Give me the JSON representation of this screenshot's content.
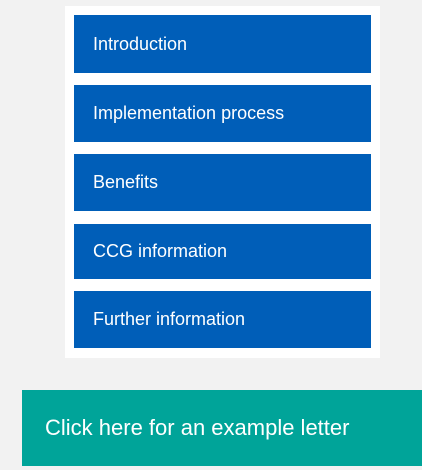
{
  "nav": {
    "items": [
      {
        "label": "Introduction"
      },
      {
        "label": "Implementation process"
      },
      {
        "label": "Benefits"
      },
      {
        "label": "CCG information"
      },
      {
        "label": "Further information"
      }
    ]
  },
  "cta": {
    "label": "Click here for an example letter"
  },
  "colors": {
    "nav_item_bg": "#005eb8",
    "cta_bg": "#00a499",
    "page_bg": "#f2f2f2",
    "panel_bg": "#ffffff"
  }
}
